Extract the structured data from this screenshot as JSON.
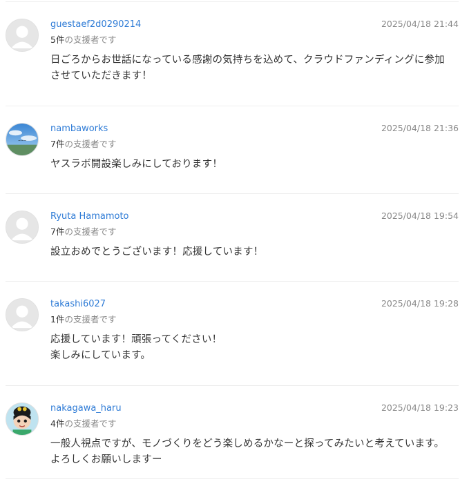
{
  "comments": [
    {
      "username": "guestaef2d0290214",
      "support_count": "5件",
      "support_suffix": "の支援者です",
      "timestamp": "2025/04/18 21:44",
      "avatar": "default-user-icon",
      "lines": [
        "日ごろからお世話になっている感謝の気持ちを込めて、クラウドファンディングに参加",
        "させていただきます！"
      ]
    },
    {
      "username": "nambaworks",
      "support_count": "7件",
      "support_suffix": "の支援者です",
      "timestamp": "2025/04/18 21:36",
      "avatar": "sky-photo-icon",
      "lines": [
        "ヤスラボ開設楽しみにしております！"
      ]
    },
    {
      "username": "Ryuta Hamamoto",
      "support_count": "7件",
      "support_suffix": "の支援者です",
      "timestamp": "2025/04/18 19:54",
      "avatar": "default-user-icon",
      "lines": [
        "設立おめでとうございます！応援しています！"
      ]
    },
    {
      "username": "takashi6027",
      "support_count": "1件",
      "support_suffix": "の支援者です",
      "timestamp": "2025/04/18 19:28",
      "avatar": "default-user-icon",
      "lines": [
        "応援しています！頑張ってください！",
        "楽しみにしています。"
      ]
    },
    {
      "username": "nakagawa_haru",
      "support_count": "4件",
      "support_suffix": "の支援者です",
      "timestamp": "2025/04/18 19:23",
      "avatar": "cartoon-character-icon",
      "lines": [
        "一般人視点ですが、モノづくりをどう楽しめるかなーと探ってみたいと考えています。",
        "よろしくお願いしますー"
      ]
    }
  ]
}
